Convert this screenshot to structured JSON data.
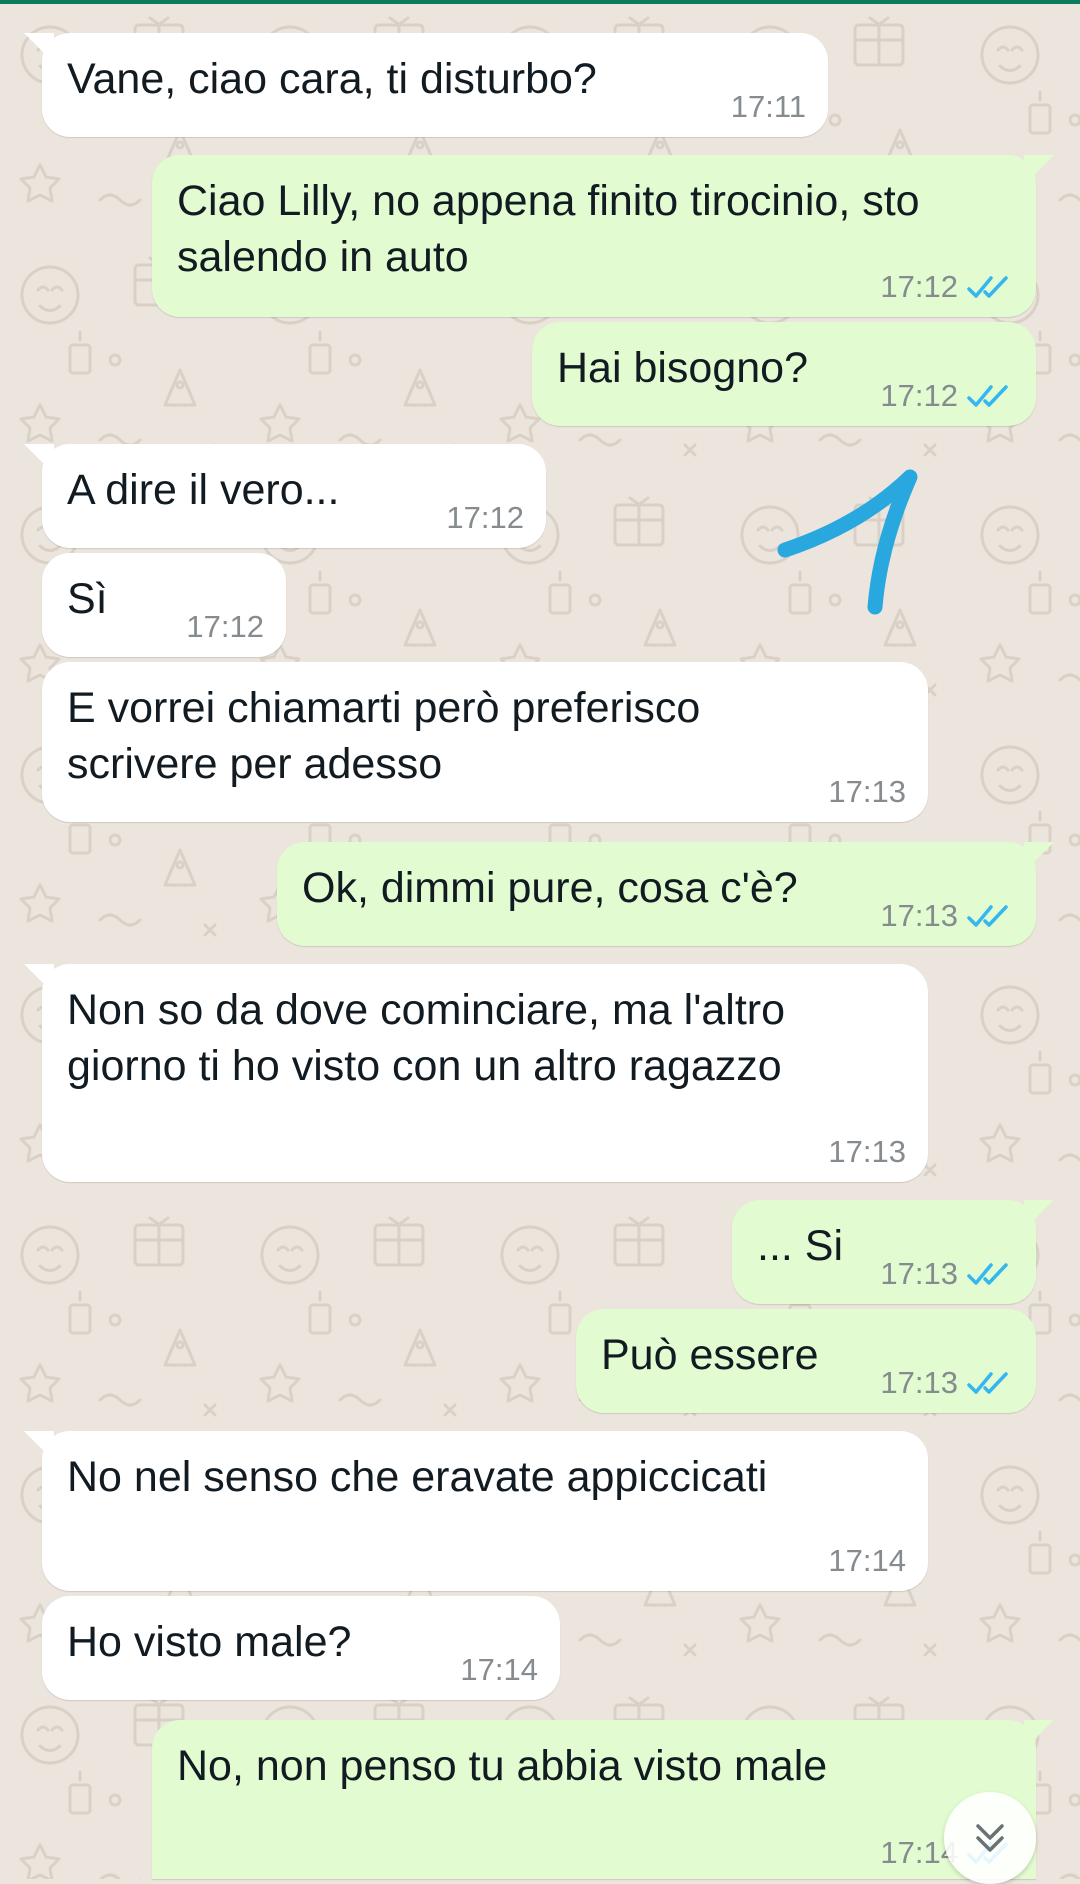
{
  "messages": [
    {
      "text": "Vane, ciao cara, ti disturbo?",
      "time": "17:11",
      "direction": "in"
    },
    {
      "text": "Ciao Lilly, no appena finito tirocinio, sto\nsalendo in auto",
      "time": "17:12",
      "direction": "out",
      "status": "read"
    },
    {
      "text": "Hai bisogno?",
      "time": "17:12",
      "direction": "out",
      "status": "read"
    },
    {
      "text": "A dire il vero...",
      "time": "17:12",
      "direction": "in"
    },
    {
      "text": "Sì",
      "time": "17:12",
      "direction": "in"
    },
    {
      "text": "E vorrei chiamarti però preferisco\nscrivere per adesso",
      "time": "17:13",
      "direction": "in"
    },
    {
      "text": "Ok, dimmi pure, cosa c'è?",
      "time": "17:13",
      "direction": "out",
      "status": "read"
    },
    {
      "text": "Non so da dove cominciare, ma l'altro\ngiorno ti ho visto con un altro ragazzo",
      "time": "17:13",
      "direction": "in"
    },
    {
      "text": "... Si",
      "time": "17:13",
      "direction": "out",
      "status": "read"
    },
    {
      "text": "Può essere",
      "time": "17:13",
      "direction": "out",
      "status": "read"
    },
    {
      "text": "No nel senso che eravate appiccicati",
      "time": "17:14",
      "direction": "in"
    },
    {
      "text": "Ho visto male?",
      "time": "17:14",
      "direction": "in"
    },
    {
      "text": "No, non penso tu abbia visto male",
      "time": "17:14",
      "direction": "out",
      "status": "read"
    }
  ],
  "icons": {
    "read_receipt": "double-check-icon",
    "scroll_down": "chevron-double-down-icon"
  },
  "colors": {
    "background": "#ece5dd",
    "incoming_bubble": "#ffffff",
    "outgoing_bubble": "#e2fbd0",
    "read_tick": "#34b7f1",
    "timestamp": "#858b8f",
    "annotation": "#29a8e0",
    "top_bar": "#0d7a5c"
  }
}
